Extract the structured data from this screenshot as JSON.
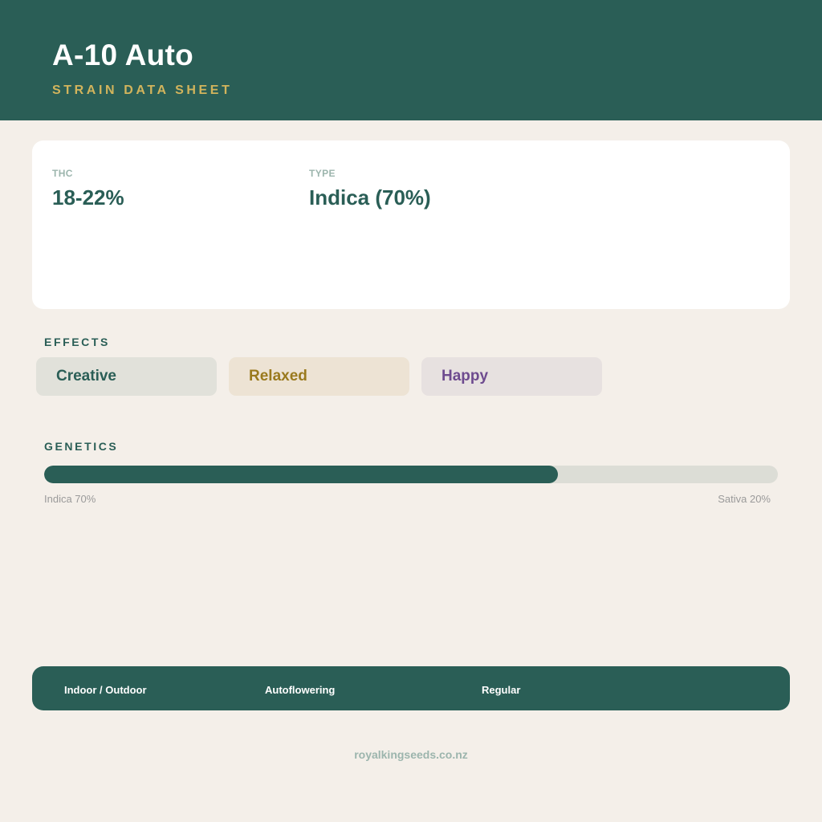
{
  "header": {
    "title": "A-10 Auto",
    "subtitle": "STRAIN DATA SHEET"
  },
  "stats": [
    {
      "label": "THC",
      "value": "18-22%"
    },
    {
      "label": "TYPE",
      "value": "Indica (70%)"
    }
  ],
  "effects": {
    "label": "EFFECTS",
    "items": [
      {
        "label": "Creative",
        "bg": "#e1e1da",
        "color": "#2a5e56"
      },
      {
        "label": "Relaxed",
        "bg": "#ede3d4",
        "color": "#9a7a1e"
      },
      {
        "label": "Happy",
        "bg": "#e7e1e0",
        "color": "#6e4b8f"
      }
    ]
  },
  "genetics": {
    "label": "GENETICS",
    "indica_fraction": 0.7,
    "indica_caption": "Indica 70%",
    "sativa_caption": "Sativa 20%"
  },
  "footer": {
    "items": [
      "Indoor / Outdoor",
      "Autoflowering",
      "Regular"
    ]
  },
  "site": "royalkingseeds.co.nz",
  "colors": {
    "primary": "#2a5e56",
    "accent": "#d2b45c",
    "background": "#f4efe9"
  }
}
